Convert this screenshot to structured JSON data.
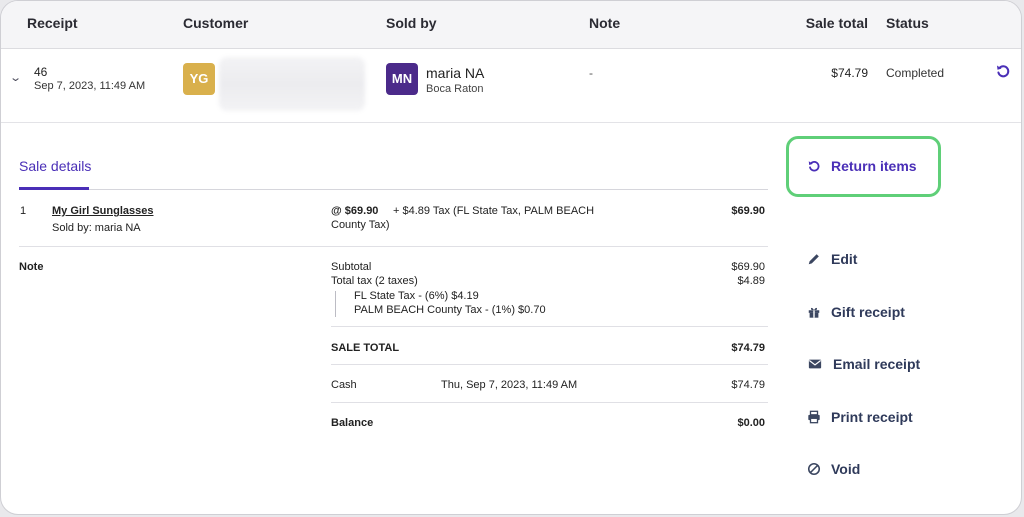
{
  "columns": {
    "receipt": "Receipt",
    "customer": "Customer",
    "sold_by": "Sold by",
    "note": "Note",
    "sale_total": "Sale total",
    "status": "Status"
  },
  "row": {
    "receipt_number": "46",
    "receipt_date": "Sep 7, 2023, 11:49 AM",
    "customer_initials": "YG",
    "customer_avatar_color": "#d9b04c",
    "seller_initials": "MN",
    "seller_avatar_color": "#4b2a8a",
    "seller_name": "maria NA",
    "seller_location": "Boca Raton",
    "note": "-",
    "sale_total": "$74.79",
    "status": "Completed"
  },
  "detail": {
    "tab_label": "Sale details",
    "item": {
      "qty": "1",
      "name": "My Girl Sunglasses",
      "sold_by": "Sold by: maria NA",
      "unit_price": "@ $69.90",
      "tax_line1": "+ $4.89 Tax (FL State Tax, PALM BEACH",
      "tax_line2": "County Tax)",
      "amount": "$69.90"
    },
    "note_label": "Note",
    "subtotal_label": "Subtotal",
    "subtotal_value": "$69.90",
    "total_tax_label": "Total tax (2 taxes)",
    "total_tax_value": "$4.89",
    "tax_breakdown_1": "FL State Tax - (6%) $4.19",
    "tax_breakdown_2": "PALM BEACH County Tax - (1%) $0.70",
    "sale_total_label": "SALE TOTAL",
    "sale_total_value": "$74.79",
    "payment_method": "Cash",
    "payment_date": "Thu, Sep 7, 2023, 11:49 AM",
    "payment_amount": "$74.79",
    "balance_label": "Balance",
    "balance_value": "$0.00"
  },
  "actions": {
    "return_items": "Return items",
    "edit": "Edit",
    "gift_receipt": "Gift receipt",
    "email_receipt": "Email receipt",
    "print_receipt": "Print receipt",
    "void": "Void"
  },
  "colors": {
    "accent": "#4a2fb7",
    "highlight": "#5fcf78"
  }
}
